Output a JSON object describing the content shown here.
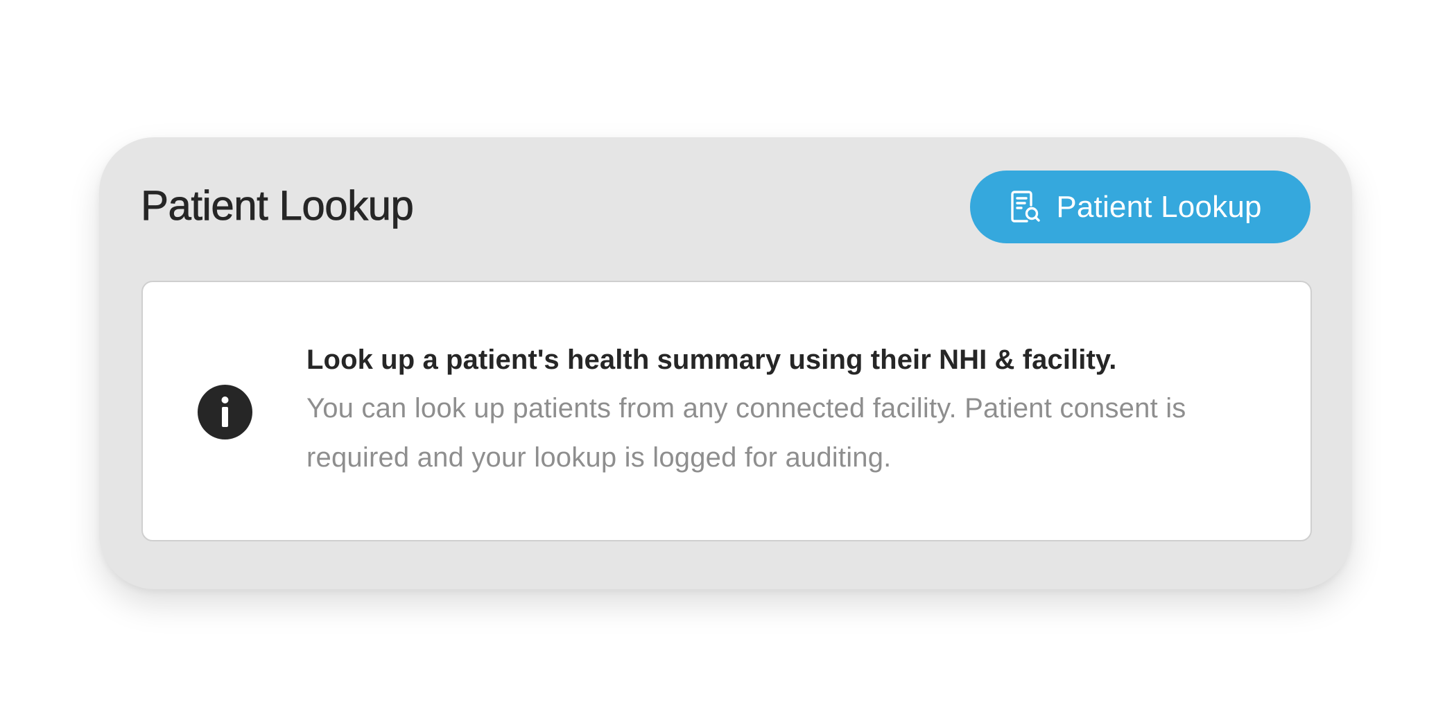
{
  "card": {
    "title": "Patient Lookup",
    "button": {
      "label": "Patient Lookup",
      "icon": "document-search-icon",
      "color": "#35a8dd"
    }
  },
  "info": {
    "icon": "info-icon",
    "heading": "Look up a patient's health summary using their NHI & facility.",
    "body": "You can look up patients from any connected facility. Patient consent is required and your lookup is logged for auditing."
  }
}
